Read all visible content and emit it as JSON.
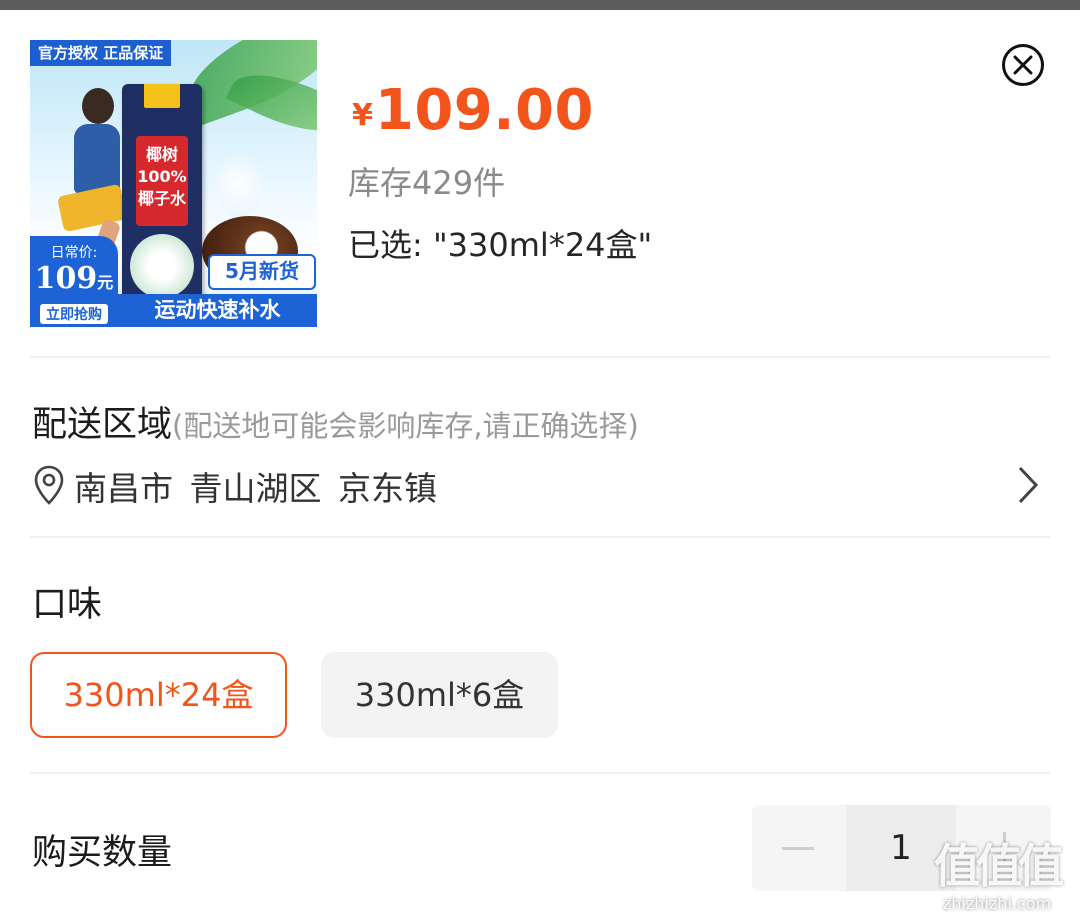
{
  "product": {
    "image": {
      "badge": "官方授权 正品保证",
      "brand_text": "椰树 100% 椰子水",
      "daily_price_label": "日常价:",
      "daily_price_value": "109",
      "daily_price_unit": "元",
      "buy_now": "立即抢购",
      "new_stock": "5月新货",
      "slogan": "运动快速补水"
    },
    "currency": "¥",
    "price": "109.00",
    "stock": "库存429件",
    "selected": "已选: \"330ml*24盒\""
  },
  "delivery": {
    "title": "配送区域",
    "hint": "(配送地可能会影响库存,请正确选择)",
    "address": "南昌市 青山湖区 京东镇"
  },
  "flavor": {
    "title": "口味",
    "options": [
      {
        "label": "330ml*24盒",
        "selected": true
      },
      {
        "label": "330ml*6盒",
        "selected": false
      }
    ]
  },
  "quantity": {
    "title": "购买数量",
    "value": "1"
  },
  "watermark": {
    "logo": "值值值",
    "url": "zhizhizhi.com"
  },
  "colors": {
    "accent": "#f2541b",
    "topbar": "#5c5c5c",
    "divider": "#efefef"
  }
}
